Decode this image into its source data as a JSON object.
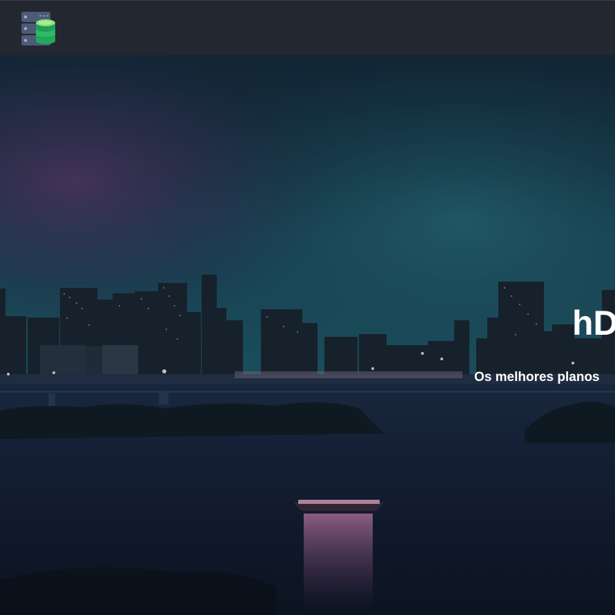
{
  "header": {
    "logo_icon": "database-server-icon"
  },
  "hero": {
    "title": "hD",
    "subtitle": "Os melhores planos",
    "background": "night-city-skyline-over-water"
  },
  "colors": {
    "navbar": "#23272f",
    "hero_text": "#ffffff",
    "logo_green": "#4cc36a",
    "logo_slate": "#4d5a78"
  }
}
